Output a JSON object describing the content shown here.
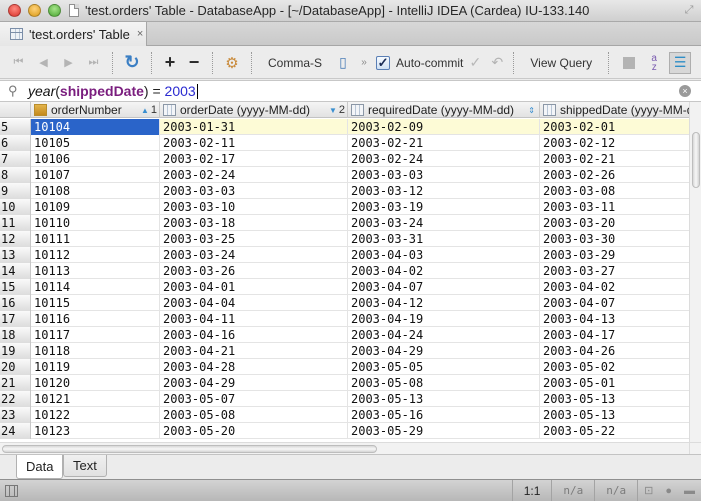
{
  "window": {
    "title": "'test.orders' Table - DatabaseApp - [~/DatabaseApp] - IntelliJ IDEA (Cardea) IU-133.140"
  },
  "editor_tab": {
    "label": "'test.orders' Table",
    "close": "×"
  },
  "toolbar": {
    "first_icon": "⏮",
    "prev_icon": "◀",
    "next_icon": "▶",
    "last_icon": "⏭",
    "refresh_icon": "↻",
    "add_icon": "+",
    "remove_icon": "−",
    "settings_icon": "⚙",
    "format_label": "Comma-S",
    "export_icon": "▯",
    "more_icon": "»",
    "autocommit_checked": true,
    "autocommit_check": "✓",
    "autocommit_label": "Auto-commit",
    "commit_icon": "✓",
    "rollback_icon": "↶",
    "view_query_label": "View Query",
    "sort_a": "a",
    "sort_z": "z",
    "filter_icon": "☰"
  },
  "filter": {
    "fn": "year",
    "open": "(",
    "arg": "shippedDate",
    "close_eq": ") = ",
    "value": "2003",
    "search_icon": "⚲",
    "clear_icon": "×"
  },
  "grid": {
    "columns": [
      {
        "name": "orderNumber",
        "sort_dir": "▲",
        "sort_order": "1",
        "is_key": true
      },
      {
        "name": "orderDate (yyyy-MM-dd)",
        "sort_dir": "▼",
        "sort_order": "2"
      },
      {
        "name": "requiredDate (yyyy-MM-dd)",
        "sort_dir": "⇕",
        "sort_order": ""
      },
      {
        "name": "shippedDate (yyyy-MM-dd)",
        "sort_dir": "",
        "sort_order": ""
      }
    ],
    "rows": [
      {
        "n": "5",
        "orderNumber": "10104",
        "orderDate": "2003-01-31",
        "requiredDate": "2003-02-09",
        "shippedDate": "2003-02-01"
      },
      {
        "n": "6",
        "orderNumber": "10105",
        "orderDate": "2003-02-11",
        "requiredDate": "2003-02-21",
        "shippedDate": "2003-02-12"
      },
      {
        "n": "7",
        "orderNumber": "10106",
        "orderDate": "2003-02-17",
        "requiredDate": "2003-02-24",
        "shippedDate": "2003-02-21"
      },
      {
        "n": "8",
        "orderNumber": "10107",
        "orderDate": "2003-02-24",
        "requiredDate": "2003-03-03",
        "shippedDate": "2003-02-26"
      },
      {
        "n": "9",
        "orderNumber": "10108",
        "orderDate": "2003-03-03",
        "requiredDate": "2003-03-12",
        "shippedDate": "2003-03-08"
      },
      {
        "n": "10",
        "orderNumber": "10109",
        "orderDate": "2003-03-10",
        "requiredDate": "2003-03-19",
        "shippedDate": "2003-03-11"
      },
      {
        "n": "11",
        "orderNumber": "10110",
        "orderDate": "2003-03-18",
        "requiredDate": "2003-03-24",
        "shippedDate": "2003-03-20"
      },
      {
        "n": "12",
        "orderNumber": "10111",
        "orderDate": "2003-03-25",
        "requiredDate": "2003-03-31",
        "shippedDate": "2003-03-30"
      },
      {
        "n": "13",
        "orderNumber": "10112",
        "orderDate": "2003-03-24",
        "requiredDate": "2003-04-03",
        "shippedDate": "2003-03-29"
      },
      {
        "n": "14",
        "orderNumber": "10113",
        "orderDate": "2003-03-26",
        "requiredDate": "2003-04-02",
        "shippedDate": "2003-03-27"
      },
      {
        "n": "15",
        "orderNumber": "10114",
        "orderDate": "2003-04-01",
        "requiredDate": "2003-04-07",
        "shippedDate": "2003-04-02"
      },
      {
        "n": "16",
        "orderNumber": "10115",
        "orderDate": "2003-04-04",
        "requiredDate": "2003-04-12",
        "shippedDate": "2003-04-07"
      },
      {
        "n": "17",
        "orderNumber": "10116",
        "orderDate": "2003-04-11",
        "requiredDate": "2003-04-19",
        "shippedDate": "2003-04-13"
      },
      {
        "n": "18",
        "orderNumber": "10117",
        "orderDate": "2003-04-16",
        "requiredDate": "2003-04-24",
        "shippedDate": "2003-04-17"
      },
      {
        "n": "19",
        "orderNumber": "10118",
        "orderDate": "2003-04-21",
        "requiredDate": "2003-04-29",
        "shippedDate": "2003-04-26"
      },
      {
        "n": "20",
        "orderNumber": "10119",
        "orderDate": "2003-04-28",
        "requiredDate": "2003-05-05",
        "shippedDate": "2003-05-02"
      },
      {
        "n": "21",
        "orderNumber": "10120",
        "orderDate": "2003-04-29",
        "requiredDate": "2003-05-08",
        "shippedDate": "2003-05-01"
      },
      {
        "n": "22",
        "orderNumber": "10121",
        "orderDate": "2003-05-07",
        "requiredDate": "2003-05-13",
        "shippedDate": "2003-05-13"
      },
      {
        "n": "23",
        "orderNumber": "10122",
        "orderDate": "2003-05-08",
        "requiredDate": "2003-05-16",
        "shippedDate": "2003-05-13"
      },
      {
        "n": "24",
        "orderNumber": "10123",
        "orderDate": "2003-05-20",
        "requiredDate": "2003-05-29",
        "shippedDate": "2003-05-22"
      }
    ],
    "selected_row_index": 0,
    "selected_column": "orderNumber"
  },
  "bottom_tabs": {
    "data": "Data",
    "text": "Text",
    "active": "Data"
  },
  "status": {
    "position": "1:1",
    "encoding": "n/a",
    "line_sep": "n/a",
    "lock_icon": "🔓",
    "inspector_icon": "●",
    "events_icon": "▬"
  },
  "colors": {
    "selection": "#2a64c9",
    "current_row": "#fdfbd6",
    "filter_arg": "#7a1d7e",
    "filter_value": "#2b2bd1"
  }
}
